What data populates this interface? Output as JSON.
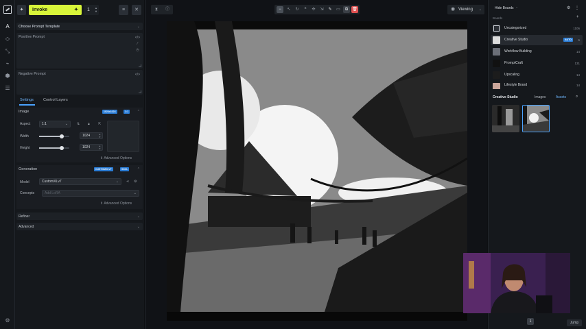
{
  "toolbar": {
    "invoke_label": "Invoke",
    "quantity": "1"
  },
  "prompts": {
    "template_label": "Choose Prompt Template",
    "positive_label": "Positive Prompt",
    "negative_label": "Negative Prompt"
  },
  "tabs": [
    "Settings",
    "Control Layers"
  ],
  "image": {
    "title": "Image",
    "badges": [
      "1024x1024",
      "1:1"
    ],
    "aspect_label": "Aspect",
    "aspect_value": "1:1",
    "width_label": "Width",
    "width_value": "1024",
    "height_label": "Height",
    "height_value": "1024",
    "advanced_label": "Advanced Options"
  },
  "generation": {
    "title": "Generation",
    "badges": [
      "CUSTOMXLV7",
      "SDXL"
    ],
    "model_label": "Model",
    "model_value": "CustomXLv7",
    "concepts_label": "Concepts",
    "concepts_placeholder": "Add LoRA",
    "advanced_label": "Advanced Options"
  },
  "refiner_label": "Refiner",
  "advanced_label": "Advanced",
  "viewer": {
    "viewing_label": "Viewing"
  },
  "boards": {
    "hide_label": "Hide Boards",
    "section_label": "Boards",
    "items": [
      {
        "name": "Uncategorized",
        "count": "1106"
      },
      {
        "name": "Creative Studio",
        "count": "6",
        "auto": "AUTO"
      },
      {
        "name": "Workflow Building",
        "count": "14"
      },
      {
        "name": "PromptCraft",
        "count": "131"
      },
      {
        "name": "Upscaling",
        "count": "14"
      },
      {
        "name": "Lifestyle Brand",
        "count": "14"
      }
    ]
  },
  "gallery": {
    "board_title": "Creative Studio",
    "tabs": [
      "Images",
      "Assets"
    ],
    "page": "1",
    "jump_label": "Jump"
  },
  "colors": {
    "accent": "#d8f53a",
    "blue": "#4aa3ff",
    "stop": "#e05252"
  }
}
